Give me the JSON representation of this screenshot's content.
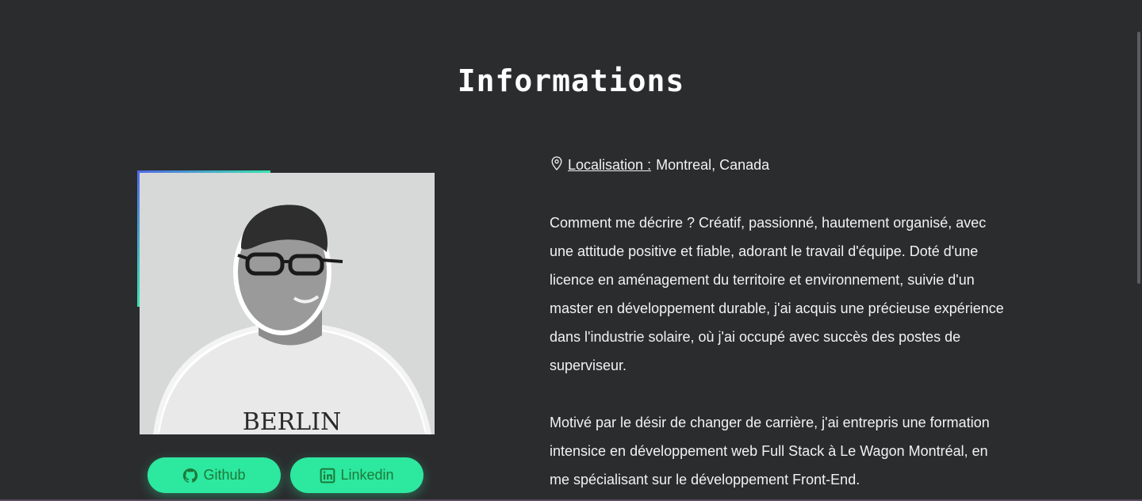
{
  "section": {
    "title": "Informations"
  },
  "profile": {
    "shirt_text": "BERLIN"
  },
  "buttons": {
    "github_label": "Github",
    "linkedin_label": "Linkedin"
  },
  "location": {
    "label": "Localisation :",
    "value": "Montreal, Canada"
  },
  "paragraphs": [
    "Comment me décrire ? Créatif, passionné, hautement organisé, avec une attitude positive et fiable, adorant le travail d'équipe. Doté d'une licence en aménagement du territoire et environnement, suivie d'un master en développement durable, j'ai acquis une précieuse expérience dans l'industrie solaire, où j'ai occupé avec succès des postes de superviseur.",
    "Motivé par le désir de changer de carrière, j'ai entrepris une formation intensice en développement web Full Stack à Le Wagon Montréal, en me spécialisant sur le développement Front-End."
  ],
  "colors": {
    "background": "#2b2c2e",
    "button": "#2de89f",
    "button_text": "#1d7a3a",
    "accent_start": "#4f68e6",
    "accent_end": "#38e3ae"
  },
  "icons": [
    "map-pin-icon",
    "github-icon",
    "linkedin-icon"
  ]
}
